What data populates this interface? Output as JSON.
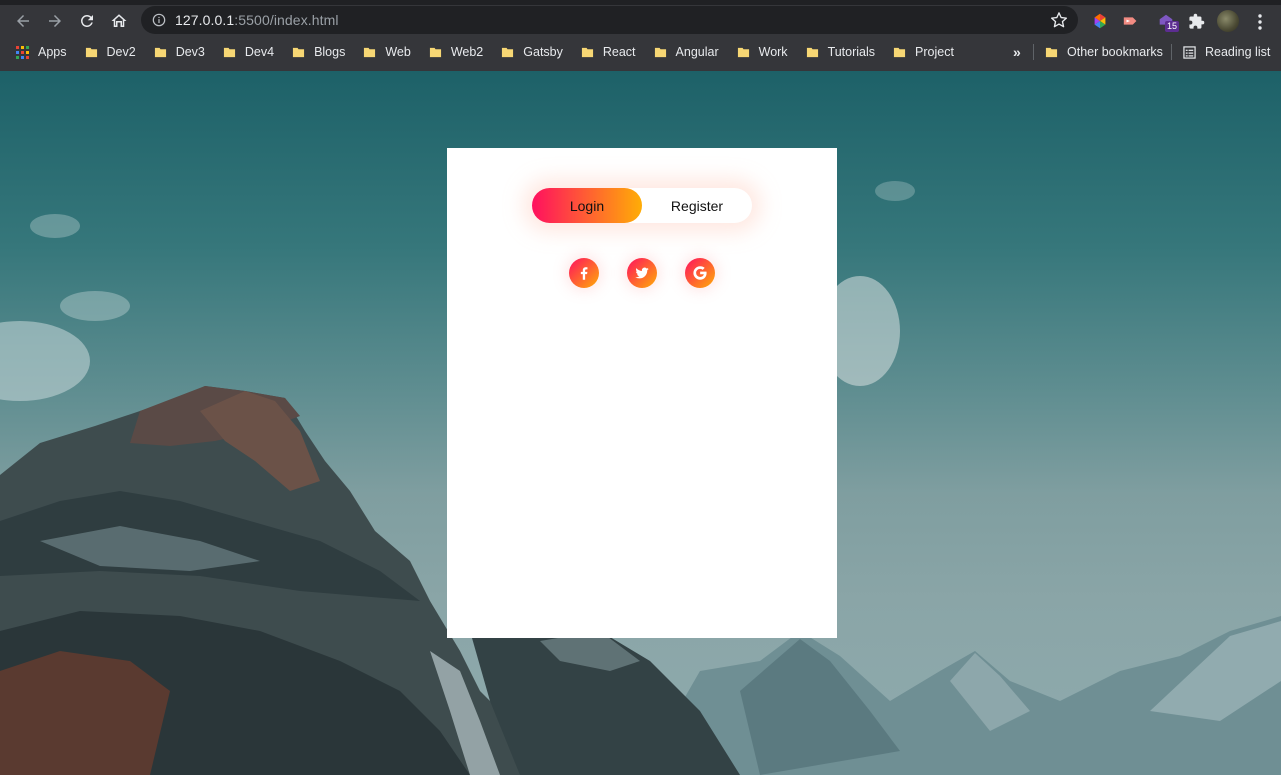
{
  "browser": {
    "url_host": "127.0.0.1",
    "url_path": ":5500/index.html",
    "extension_badge": "15",
    "bookmarks": [
      {
        "label": "Apps"
      },
      {
        "label": "Dev2"
      },
      {
        "label": "Dev3"
      },
      {
        "label": "Dev4"
      },
      {
        "label": "Blogs"
      },
      {
        "label": "Web"
      },
      {
        "label": "Web2"
      },
      {
        "label": "Gatsby"
      },
      {
        "label": "React"
      },
      {
        "label": "Angular"
      },
      {
        "label": "Work"
      },
      {
        "label": "Tutorials"
      },
      {
        "label": "Project"
      }
    ],
    "overflow_label": "»",
    "other_bookmarks": "Other bookmarks",
    "reading_list": "Reading list"
  },
  "form": {
    "login_tab": "Login",
    "register_tab": "Register",
    "active_tab": "login",
    "social_icons": [
      "facebook-icon",
      "twitter-icon",
      "google-icon"
    ]
  },
  "colors": {
    "gradient_start": "#ff105f",
    "gradient_end": "#ffad06",
    "folder": "#f7d774"
  }
}
